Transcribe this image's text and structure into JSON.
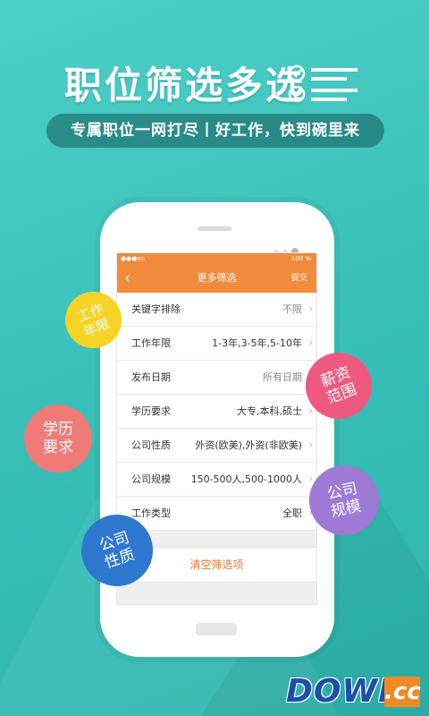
{
  "promo": {
    "headline": "职位筛选多选",
    "subtitle": "专属职位一网打尽丨好工作，快到碗里来"
  },
  "screen": {
    "status": {
      "signal": "●●●oo",
      "battery": "100 %"
    },
    "nav": {
      "back_icon": "chevron-left-icon",
      "title": "更多筛选",
      "submit": "提交"
    },
    "filters": [
      {
        "label": "关键字排除",
        "value": "不限"
      },
      {
        "label": "工作年限",
        "value": "1-3年,3-5年,5-10年"
      },
      {
        "label": "发布日期",
        "value": "所有日期"
      },
      {
        "label": "学历要求",
        "value": "大专,本科,硕士"
      },
      {
        "label": "公司性质",
        "value": "外资(欧美),外资(非欧美)"
      },
      {
        "label": "公司规模",
        "value": "150-500人,500-1000人"
      },
      {
        "label": "工作类型",
        "value": "全职"
      }
    ],
    "clear_button": "清空筛选项"
  },
  "bubbles": {
    "work_years": "工作\n年限",
    "salary": "薪资\n范围",
    "education": "学历\n要求",
    "company_size": "公司\n规模",
    "company_type": "公司\n性质"
  },
  "watermark": {
    "main": "DOWN",
    "suffix": ".cc"
  },
  "colors": {
    "accent": "#f28c3c",
    "background": "#3cc3bd"
  }
}
